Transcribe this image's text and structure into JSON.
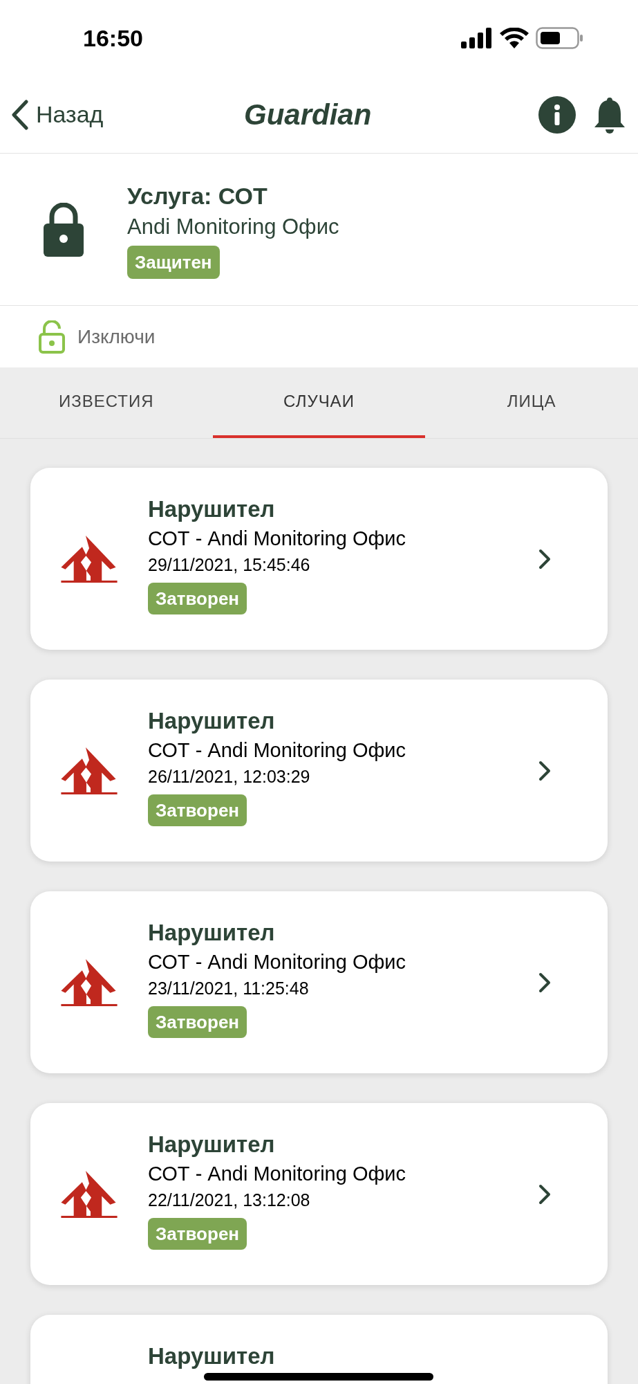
{
  "status_bar": {
    "time": "16:50"
  },
  "nav": {
    "back": "Назад",
    "title": "Guardian"
  },
  "service": {
    "title": "Услуга: СОТ",
    "name": "Andi Monitoring Офис",
    "badge": "Защитен",
    "locked": true
  },
  "action": {
    "label": "Изключи"
  },
  "tabs": [
    {
      "label": "ИЗВЕСТИЯ",
      "selected": false
    },
    {
      "label": "СЛУЧАИ",
      "selected": true
    },
    {
      "label": "ЛИЦА",
      "selected": false
    }
  ],
  "cases": [
    {
      "title": "Нарушител",
      "source": "СОТ - Andi Monitoring Офис",
      "time": "29/11/2021, 15:45:46",
      "badge": "Затворен"
    },
    {
      "title": "Нарушител",
      "source": "СОТ - Andi Monitoring Офис",
      "time": "26/11/2021, 12:03:29",
      "badge": "Затворен"
    },
    {
      "title": "Нарушител",
      "source": "СОТ - Andi Monitoring Офис",
      "time": "23/11/2021, 11:25:48",
      "badge": "Затворен"
    },
    {
      "title": "Нарушител",
      "source": "СОТ - Andi Monitoring Офис",
      "time": "22/11/2021, 13:12:08",
      "badge": "Затворен"
    },
    {
      "title": "Нарушител"
    }
  ]
}
